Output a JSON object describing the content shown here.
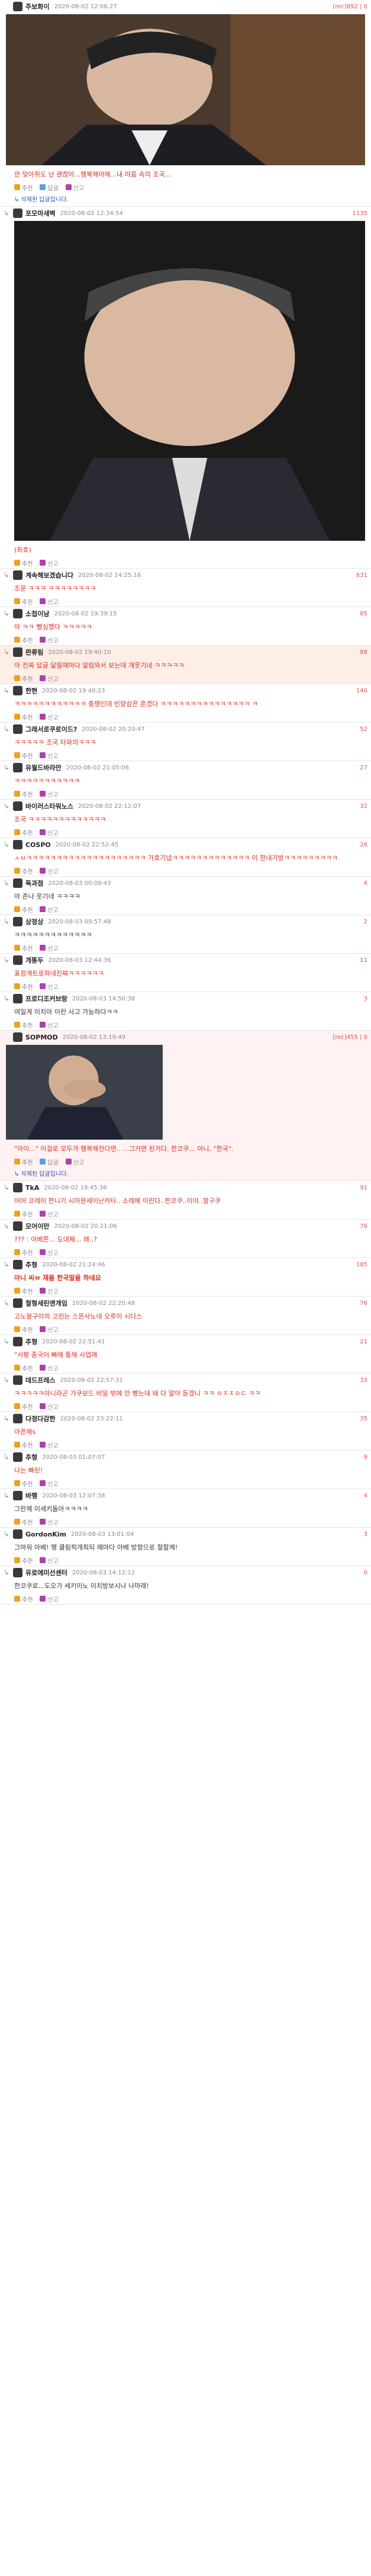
{
  "posts": [
    {
      "name": "주보화이",
      "date": "2020-08-02 12:06:27",
      "likes": "[rec]892 | 0",
      "text": "안 맞아쥐도 난 괜찮아...행복해야해...내 마음 속의 조국...",
      "color": "red",
      "image": "abe"
    },
    {
      "name": "포모마새벽",
      "date": "2020-08-02 12:34:54",
      "likes": "1135",
      "text": "(좌호)",
      "color": "red",
      "image": "cho"
    },
    {
      "name": "계속해보겠습니다",
      "date": "2020-08-02 14:25:16",
      "likes": "631",
      "text": "조문 ㅋㅋㅋ ㅋㅋㅋㅋㅋㅋㅋㅋ",
      "color": "red"
    },
    {
      "name": "소첩이남",
      "date": "2020-08-02 19:39:15",
      "likes": "85",
      "text": "아 ㅋㅋ 빵심했다 ㅋㅋㅋㅋㅋ",
      "color": "red"
    },
    {
      "name": "판류림",
      "date": "2020-08-02 19:40:10",
      "likes": "88",
      "text": "아 진짜 답글 달릴때마다 알림와서 보는데 개웃기네 ㅋㅋㅋㅋㅋ",
      "color": "red",
      "highlight": true
    },
    {
      "name": "한현",
      "date": "2020-08-02 19:40:23",
      "likes": "140",
      "text": "ㅋㅋㅋㅋㅋㅋㅋㅋㅋㅋㅋㅋ 충쟁인데 빈양심은 흔겠다 ㅋㅋㅋㅋㅋㅋㅋㅋㅋㅋㅋㅋㅋㅋㅋ ㅋ",
      "color": "red"
    },
    {
      "name": "그래서로쿠로이드?",
      "date": "2020-08-02 20:20:47",
      "likes": "52",
      "text": "ㅋㅋㅋㅋㅋ 조국 타와의ㅋㅋㅋ",
      "color": "red"
    },
    {
      "name": "유월드바라만",
      "date": "2020-08-02 21:05:06",
      "likes": "27",
      "text": "ㅋㅋㅋㅋㅋㅋㅋㅋㅋㅋㅋ",
      "color": "red"
    },
    {
      "name": "바이러스타워노스",
      "date": "2020-08-02 22:12:07",
      "likes": "32",
      "text": "조국 ㅋㅋㅋㅋㅋㅋㅋㅋㅋㅋㅋㅋㅋ",
      "color": "red"
    },
    {
      "name": "COSPO",
      "date": "2020-08-02 22:52:45",
      "likes": "26",
      "text": "ㅅㅂㅋㅋㅋㅋㅋㅋㅋㅋㅋㅋㅋㅋㅋㅋㅋㅋㅋㅋㅋㅋ 가호기냅ㅋㅋㅋㅋㅋㅋㅋㅋㅋㅋㅋㅋㅋ 이 한내가방ㅋㅋㅋㅋㅋㅋㅋㅋㅋ",
      "color": "red"
    },
    {
      "name": "독과점",
      "date": "2020-08-03 00:09:43",
      "likes": "4",
      "text": "아 존나 웃기네 ㅋㅋㅋㅋ",
      "color": "dark"
    },
    {
      "name": "상정상",
      "date": "2020-08-03 09:57:48",
      "likes": "2",
      "text": "ㅋㅋㅋㅋㅋㅋㅋㅋㅋㅋㅋㅋㅋ",
      "color": "dark"
    },
    {
      "name": "개똥두",
      "date": "2020-08-03 12:44:36",
      "likes": "11",
      "text": "표정개트로하네진짜ㅋㅋㅋㅋㅋㅋ",
      "color": "red"
    },
    {
      "name": "프로디조커브랑",
      "date": "2020-08-03 14:50:38",
      "likes": "3",
      "text": "여일게 이치아 이런 사고 가능하다ㅋㅋ",
      "color": "dark"
    },
    {
      "name": "SOPMOD",
      "date": "2020-08-02 13:19:49",
      "likes": "[rec]455 | 0",
      "text": "\"아이...\" 이걸로 모두가 행복해진다면.. ...그거면 된거다. 한코쿠... 아니, \"한국\".",
      "color": "red",
      "image": "pm",
      "top": true
    },
    {
      "name": "TkA",
      "date": "2020-08-02 19:45:36",
      "likes": "91",
      "text": "어머 코레이 한니기 시마완세이난카타.. 소레에 이린다..한코쿠..이야..항구쿠",
      "color": "red"
    },
    {
      "name": "모어이만",
      "date": "2020-08-02 20:21:06",
      "likes": "76",
      "text": "??? : 아베쫀... 도대체... 왜..?",
      "color": "red"
    },
    {
      "name": "추형",
      "date": "2020-08-02 21:24:46",
      "likes": "185",
      "text": "아니 씨ㅂ 재들 한국말을 하네요",
      "color": "red",
      "bold": true
    },
    {
      "name": "철형세린앤개임",
      "date": "2020-08-02 22:20:48",
      "likes": "76",
      "text": "고노왕구이의 고린는 스온사노네 오루이 시다스",
      "color": "red"
    },
    {
      "name": "추형",
      "date": "2020-08-02 22:51:41",
      "likes": "21",
      "text": "\"서평 중국어 빠에 통해 사업애",
      "color": "red"
    },
    {
      "name": "데드프레스",
      "date": "2020-08-02 22:57:31",
      "likes": "33",
      "text": "ㅋㅋㅋㅋㅋ아니라곤 가쿠보드 비밀 밖에 안 빵는데 돼 다 알아 듣겠니 ㅋㅋ ㅇㅈㅈㅇㄷ ㅋㅋ",
      "color": "red"
    },
    {
      "name": "다정다감한",
      "date": "2020-08-02 23:22:11",
      "likes": "35",
      "text": "아픈해s",
      "color": "red"
    },
    {
      "name": "추형",
      "date": "2020-08-03 01:07:07",
      "likes": "9",
      "text": "나는 빠된!",
      "color": "red"
    },
    {
      "name": "바행",
      "date": "2020-08-03 12:07:38",
      "likes": "4",
      "text": "그란께 이세키돌아ㅋㅋㅋㅋ",
      "color": "dark"
    },
    {
      "name": "GordonKim",
      "date": "2020-08-03 13:01:04",
      "likes": "3",
      "text": "그마워 아베! 행 클림픽개최되 떼마다 아베 방향으로 절할께!",
      "color": "dark"
    },
    {
      "name": "유로에미선센터",
      "date": "2020-08-03 14:12:12",
      "likes": "0",
      "text": "한코쿠로...도오가 세키이노 이치방보시나 나마래!",
      "color": "dark"
    }
  ],
  "actions": {
    "recommend": "추천",
    "reply": "답글",
    "report": "신고"
  },
  "notes": [
    "↳ 삭제된 답글입니다.",
    "↳ 삭제된 답글입니다."
  ]
}
